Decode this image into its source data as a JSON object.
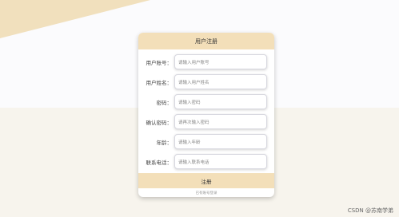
{
  "colors": {
    "header_band": "#f3dfb9",
    "page_top": "#fbfbfd",
    "page_bottom": "#f7f4ed",
    "wedge": "#f1e0bd"
  },
  "form": {
    "title": "用户注册",
    "fields": [
      {
        "label": "用户账号：",
        "placeholder": "请输入用户账号"
      },
      {
        "label": "用户姓名：",
        "placeholder": "请输入用户姓名"
      },
      {
        "label": "密码：",
        "placeholder": "请输入密码"
      },
      {
        "label": "确认密码：",
        "placeholder": "请再次输入密码"
      },
      {
        "label": "年龄：",
        "placeholder": "请输入年龄"
      },
      {
        "label": "联系电话：",
        "placeholder": "请输入联系电话"
      }
    ],
    "submit_label": "注册",
    "login_link": "已有账号登录"
  },
  "watermark": "CSDN @苏南学弟"
}
